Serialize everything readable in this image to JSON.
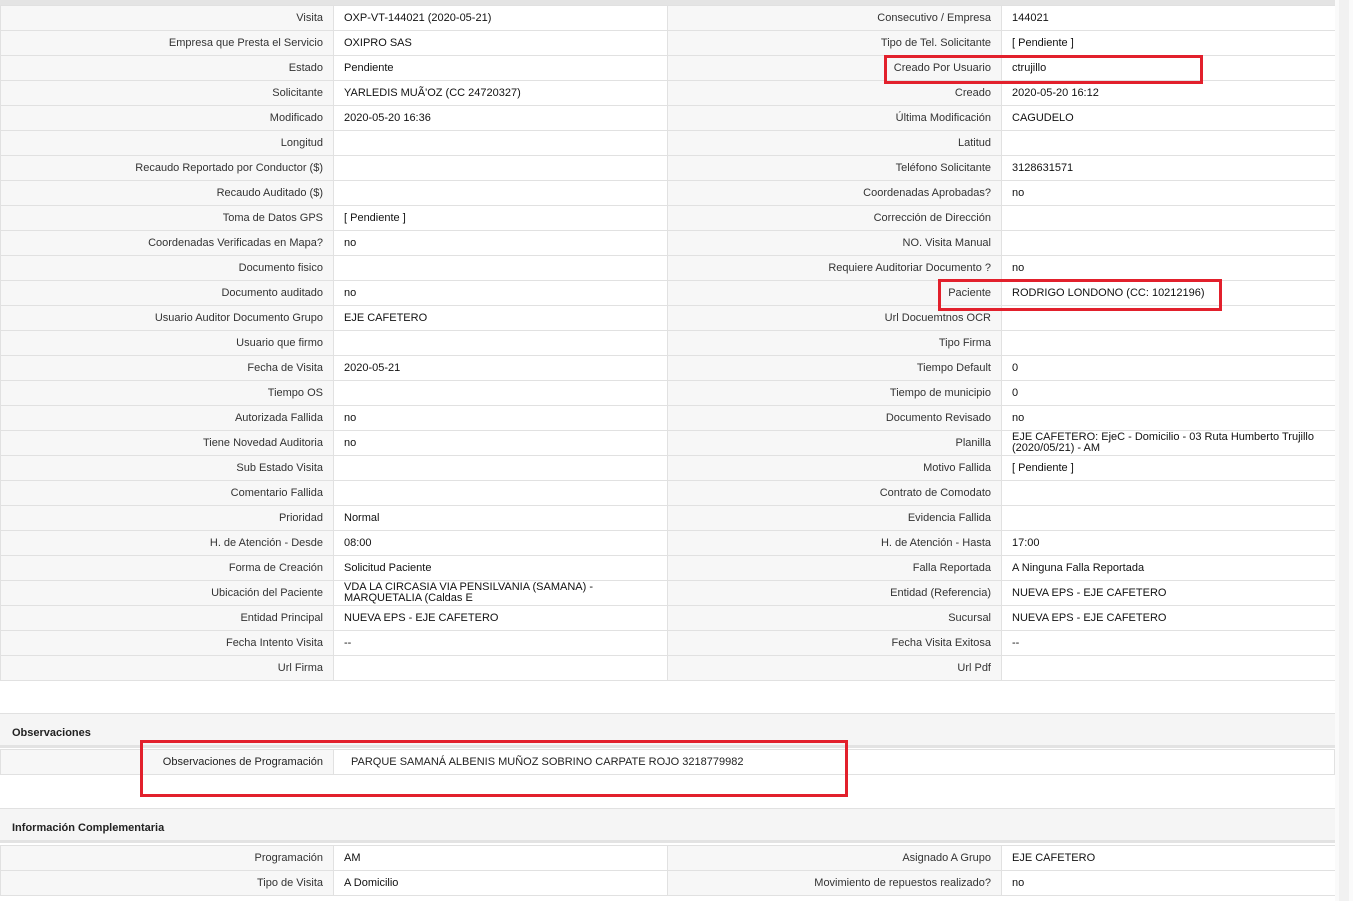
{
  "details": {
    "rows": [
      {
        "l1": "Visita",
        "v1": "OXP-VT-144021 (2020-05-21)",
        "l2": "Consecutivo / Empresa",
        "v2": "144021"
      },
      {
        "l1": "Empresa que Presta el Servicio",
        "v1": "OXIPRO SAS",
        "l2": "Tipo de Tel. Solicitante",
        "v2": "[ Pendiente ]"
      },
      {
        "l1": "Estado",
        "v1": "Pendiente",
        "l2": "Creado Por Usuario",
        "v2": "ctrujillo"
      },
      {
        "l1": "Solicitante",
        "v1": "YARLEDIS MUÃ'OZ (CC 24720327)",
        "l2": "Creado",
        "v2": "2020-05-20 16:12"
      },
      {
        "l1": "Modificado",
        "v1": "2020-05-20 16:36",
        "l2": "Última Modificación",
        "v2": " CAGUDELO"
      },
      {
        "l1": "Longitud",
        "v1": "",
        "l2": "Latitud",
        "v2": ""
      },
      {
        "l1": "Recaudo Reportado por Conductor ($)",
        "v1": "",
        "l2": "Teléfono Solicitante",
        "v2": "3128631571"
      },
      {
        "l1": "Recaudo Auditado ($)",
        "v1": "",
        "l2": "Coordenadas Aprobadas?",
        "v2": " no"
      },
      {
        "l1": "Toma de Datos GPS",
        "v1": "[ Pendiente ]",
        "l2": "Corrección de Dirección",
        "v2": ""
      },
      {
        "l1": "Coordenadas Verificadas en Mapa?",
        "v1": " no",
        "l2": "NO. Visita Manual",
        "v2": ""
      },
      {
        "l1": "Documento fisico",
        "v1": "",
        "l2": "Requiere Auditoriar Documento ?",
        "v2": " no"
      },
      {
        "l1": "Documento auditado",
        "v1": " no",
        "l2": "Paciente",
        "v2": "RODRIGO LONDONO (CC: 10212196)"
      },
      {
        "l1": "Usuario Auditor Documento Grupo",
        "v1": "EJE CAFETERO",
        "l2": "Url Docuemtnos OCR",
        "v2": ""
      },
      {
        "l1": "Usuario que firmo",
        "v1": "",
        "l2": "Tipo Firma",
        "v2": ""
      },
      {
        "l1": "Fecha de Visita",
        "v1": " 2020-05-21",
        "l2": "Tiempo Default",
        "v2": "0"
      },
      {
        "l1": "Tiempo OS",
        "v1": "",
        "l2": "Tiempo de municipio",
        "v2": "0"
      },
      {
        "l1": "Autorizada Fallida",
        "v1": " no",
        "l2": "Documento Revisado",
        "v2": " no"
      },
      {
        "l1": "Tiene Novedad Auditoria",
        "v1": " no",
        "l2": "Planilla",
        "v2": "EJE CAFETERO: EjeC - Domicilio - 03 Ruta Humberto Trujillo (2020/05/21) - AM"
      },
      {
        "l1": "Sub Estado Visita",
        "v1": "",
        "l2": "Motivo Fallida",
        "v2": "[ Pendiente ]"
      },
      {
        "l1": "Comentario Fallida",
        "v1": "",
        "l2": "Contrato de Comodato",
        "v2": ""
      },
      {
        "l1": "Prioridad",
        "v1": "Normal",
        "l2": "Evidencia Fallida",
        "v2": ""
      },
      {
        "l1": "H. de Atención - Desde",
        "v1": "08:00",
        "l2": "H. de Atención - Hasta",
        "v2": "17:00"
      },
      {
        "l1": "Forma de Creación",
        "v1": "Solicitud Paciente",
        "l2": "Falla Reportada",
        "v2": "A Ninguna Falla Reportada"
      },
      {
        "l1": "Ubicación del Paciente",
        "v1": "VDA LA CIRCASIA VIA PENSILVANIA (SAMANA) - MARQUETALIA (Caldas E",
        "l2": "Entidad (Referencia)",
        "v2": "NUEVA EPS - EJE CAFETERO"
      },
      {
        "l1": "Entidad Principal",
        "v1": "NUEVA EPS - EJE CAFETERO",
        "l2": "Sucursal",
        "v2": "NUEVA EPS - EJE CAFETERO"
      },
      {
        "l1": "Fecha Intento Visita",
        "v1": " --",
        "l2": "Fecha Visita Exitosa",
        "v2": " --"
      },
      {
        "l1": "Url Firma",
        "v1": "",
        "l2": "Url Pdf",
        "v2": ""
      }
    ]
  },
  "observaciones": {
    "title": "Observaciones",
    "label": "Observaciones de Programación",
    "value": "PARQUE SAMANÁ ALBENIS MUÑOZ SOBRINO CARPATE ROJO 3218779982"
  },
  "complementaria": {
    "title": "Información Complementaria",
    "rows": [
      {
        "l1": "Programación",
        "v1": "AM",
        "l2": "Asignado A Grupo",
        "v2": "EJE CAFETERO"
      },
      {
        "l1": "Tipo de Visita",
        "v1": "A Domicilio",
        "l2": "Movimiento de repuestos realizado?",
        "v2": " no"
      }
    ]
  },
  "highlight_color": "#e2202c"
}
